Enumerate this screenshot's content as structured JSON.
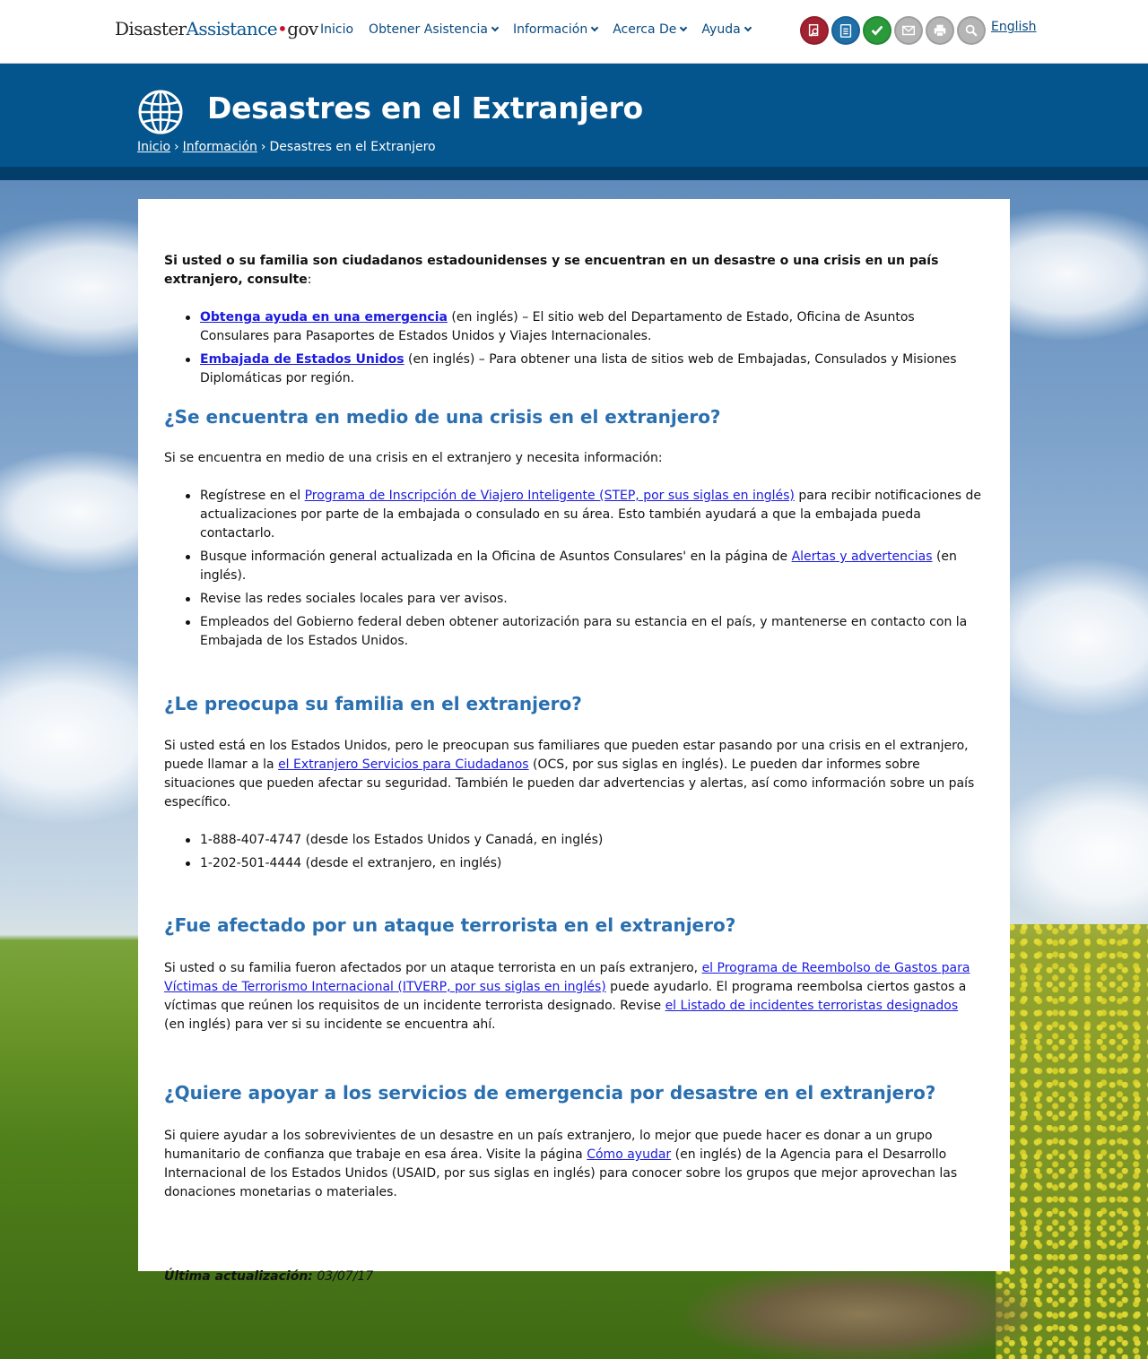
{
  "header": {
    "logo": {
      "part1": "Disaster",
      "part2": "Assistance",
      "dot": "•",
      "part3": "gov"
    },
    "nav": [
      {
        "label": "Inicio",
        "has_menu": false
      },
      {
        "label": "Obtener Asistencia",
        "has_menu": true
      },
      {
        "label": "Información",
        "has_menu": true
      },
      {
        "label": "Acerca De",
        "has_menu": true
      },
      {
        "label": "Ayuda",
        "has_menu": true
      }
    ],
    "tools": [
      {
        "icon": "search-document-icon",
        "color": "#a32232"
      },
      {
        "icon": "checklist-icon",
        "color": "#1f6fa8"
      },
      {
        "icon": "checkmark-icon",
        "color": "#2a9a3a"
      },
      {
        "icon": "envelope-icon",
        "color": "#b5b5b5"
      },
      {
        "icon": "printer-icon",
        "color": "#b5b5b5"
      },
      {
        "icon": "magnifier-icon",
        "color": "#b5b5b5"
      }
    ],
    "language_link": "English"
  },
  "banner": {
    "icon": "globe-icon",
    "title": "Desastres en el Extranjero",
    "breadcrumb": {
      "home": "Inicio",
      "sep1": "›",
      "section": "Información",
      "sep2": "›",
      "current": "Desastres en el Extranjero"
    }
  },
  "content": {
    "intro": "Si usted o su familia son ciudadanos estadounidenses y se encuentran en un desastre o una crisis en un país extranjero, consulte",
    "intro_colon": ":",
    "links": [
      {
        "link": "Obtenga ayuda en una emergencia",
        "text": " (en inglés) – El sitio web del Departamento de Estado, Oficina de Asuntos Consulares para Pasaportes de Estados Unidos y Viajes Internacionales."
      },
      {
        "link": "Embajada de Estados Unidos",
        "text": " (en inglés) – Para obtener una lista de sitios web de Embajadas, Consulados y Misiones Diplomáticas por región."
      }
    ],
    "section1": {
      "heading": "¿Se encuentra en medio de una crisis en el extranjero?",
      "lead": "Si se encuentra en medio de una crisis en el extranjero y necesita información:",
      "item1_pre": "Regístrese en el ",
      "item1_link": "Programa de Inscripción de Viajero Inteligente (STEP, por sus siglas en inglés)",
      "item1_post": " para recibir notificaciones de actualizaciones por parte de la embajada o consulado en su área. Esto también ayudará a que la embajada pueda contactarlo.",
      "item2_pre": "Busque información general actualizada en la Oficina de Asuntos Consulares' en la página de ",
      "item2_link": "Alertas y advertencias",
      "item2_post": " (en inglés).",
      "item3": "Revise las redes sociales locales para ver avisos.",
      "item4": "Empleados del Gobierno federal deben obtener autorización para su estancia en el país, y mantenerse en contacto con la Embajada de los Estados Unidos."
    },
    "section2": {
      "heading": "¿Le preocupa su familia en el extranjero?",
      "para_pre": "Si usted está en los Estados Unidos, pero le preocupan sus familiares que pueden estar pasando por una crisis en el extranjero, puede llamar a la ",
      "para_link": "el Extranjero Servicios para Ciudadanos",
      "para_post": " (OCS, por sus siglas en inglés). Le pueden dar informes sobre situaciones que pueden afectar su seguridad. También le pueden dar advertencias y alertas, así como información sobre un país específico.",
      "phones": [
        "1-888-407-4747 (desde los Estados Unidos y Canadá, en inglés)",
        "1-202-501-4444 (desde el extranjero, en inglés)"
      ]
    },
    "section3": {
      "heading": "¿Fue afectado por un ataque terrorista en el extranjero?",
      "pre": "Si usted o su familia fueron afectados por un ataque terrorista en un país extranjero, ",
      "link1": "el Programa de Reembolso de Gastos para Víctimas de Terrorismo Internacional (ITVERP, por sus siglas en inglés)",
      "mid": " puede ayudarlo. El programa reembolsa ciertos gastos a víctimas que reúnen los requisitos de un incidente terrorista designado. Revise ",
      "link2": "el Listado de incidentes terroristas designados",
      "post": " (en inglés) para ver si su incidente se encuentra ahí."
    },
    "section4": {
      "heading": "¿Quiere apoyar a los servicios de emergencia por desastre en el extranjero?",
      "pre": "Si quiere ayudar a los sobrevivientes de un desastre en un país extranjero, lo mejor que puede hacer es donar a un grupo humanitario de confianza que trabaje en esa área. Visite la página ",
      "link": "Cómo ayudar",
      "post": " (en inglés) de la Agencia para el Desarrollo Internacional de los Estados Unidos (USAID, por sus siglas en inglés) para conocer sobre los grupos que mejor aprovechan las donaciones monetarias o materiales."
    },
    "updated_label": "Última actualización:",
    "updated_date": " 03/07/17"
  }
}
